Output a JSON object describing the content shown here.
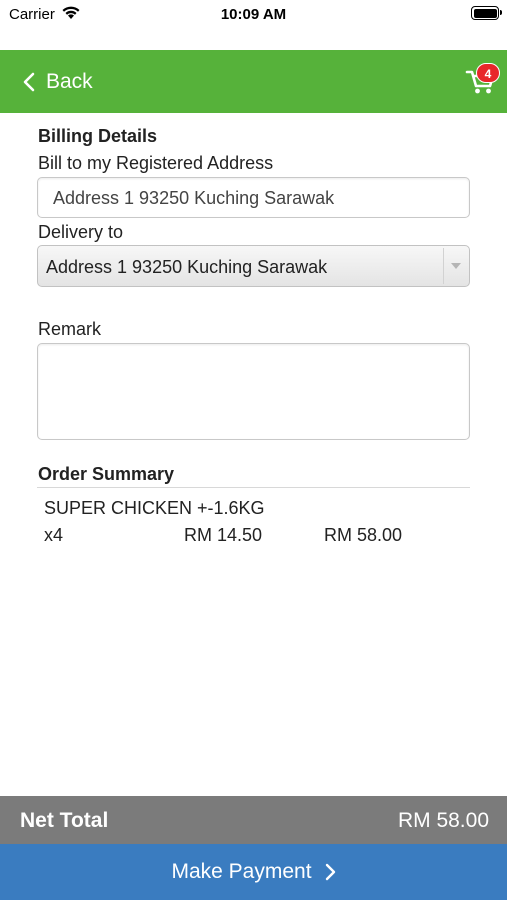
{
  "status_bar": {
    "carrier": "Carrier",
    "time": "10:09 AM"
  },
  "nav": {
    "back_label": "Back",
    "cart_badge_count": "4",
    "accent_color": "#56b23a",
    "badge_color": "#e8262a"
  },
  "billing": {
    "title": "Billing Details",
    "registered_label": "Bill to my Registered Address",
    "registered_value": "Address 1 93250 Kuching Sarawak",
    "delivery_label": "Delivery to",
    "delivery_selected": "Address 1 93250 Kuching Sarawak"
  },
  "remark": {
    "label": "Remark",
    "value": ""
  },
  "order_summary": {
    "title": "Order Summary",
    "items": [
      {
        "name": "SUPER CHICKEN +-1.6KG",
        "quantity": "x4",
        "unit_price": "RM 14.50",
        "line_total": "RM 58.00"
      }
    ]
  },
  "footer": {
    "net_total_label": "Net Total",
    "net_total_value": "RM 58.00",
    "pay_label": "Make Payment",
    "pay_color": "#3a7cc0"
  },
  "icons": {
    "back": "chevron-left-icon",
    "cart": "cart-icon",
    "select_arrow": "chevron-down-icon",
    "pay": "chevron-right-icon",
    "wifi": "wifi-icon",
    "battery": "battery-icon"
  }
}
